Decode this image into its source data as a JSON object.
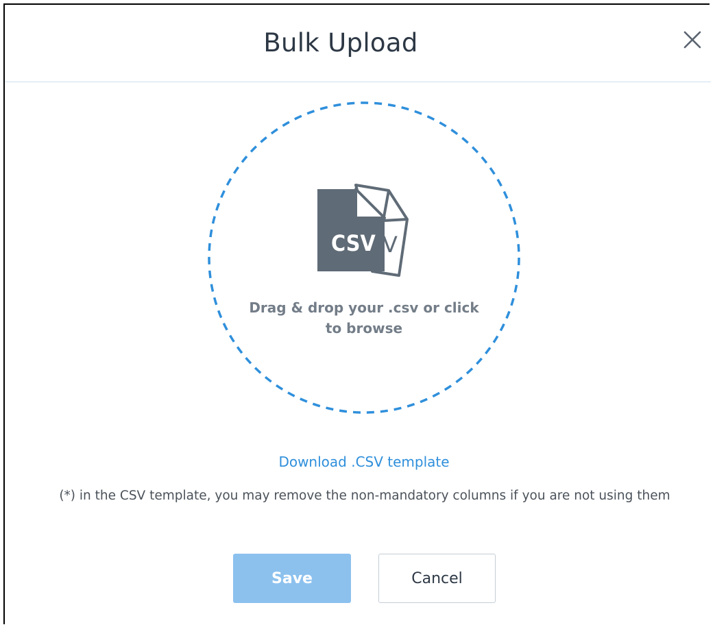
{
  "dialog": {
    "title": "Bulk Upload",
    "close_icon": "close-icon"
  },
  "dropzone": {
    "icon": "csv-file-icon",
    "icon_label": "CSV",
    "icon_back_letter": "V",
    "instruction": "Drag & drop your .csv or click to browse"
  },
  "template": {
    "download_link": "Download .CSV template",
    "note": "(*) in the CSV template, you may remove the non-mandatory columns if you are not using them"
  },
  "actions": {
    "save_label": "Save",
    "cancel_label": "Cancel"
  },
  "colors": {
    "accent": "#2f8fdb",
    "save_disabled": "#8cc1ee",
    "icon_fill": "#5f6b76",
    "dropzone_border": "#2f8fdb"
  }
}
